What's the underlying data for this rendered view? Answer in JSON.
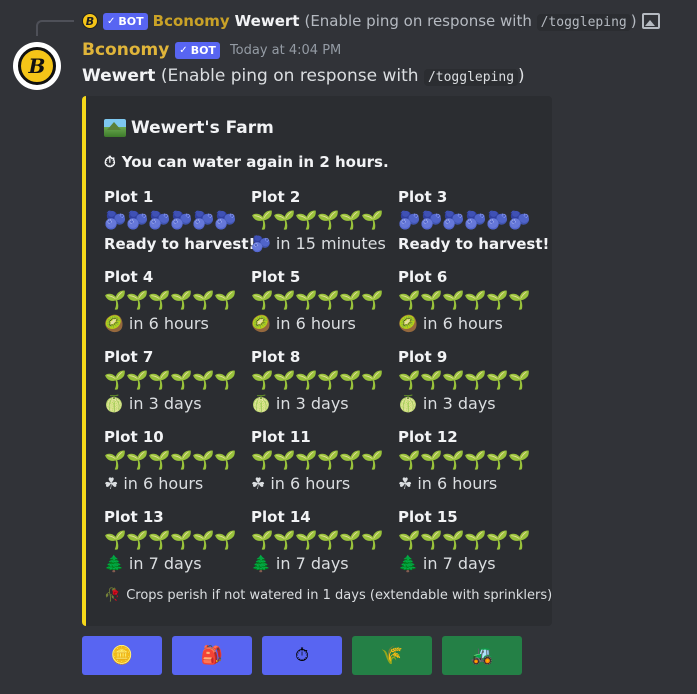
{
  "reply": {
    "bot_tag": "BOT",
    "author": "Bconomy",
    "user": "Wewert",
    "text_before": "(Enable ping on response with",
    "command": "/toggleping",
    "text_after": ")",
    "image_icon": "image-icon"
  },
  "message": {
    "avatar_letter": "B",
    "author": "Bconomy",
    "bot_tag": "BOT",
    "timestamp": "Today at 4:04 PM",
    "user": "Wewert",
    "text_before": "(Enable ping on response with",
    "command": "/toggleping",
    "text_after": ")"
  },
  "embed": {
    "accent_color": "#f6d81a",
    "title": "Wewert's Farm",
    "title_icon": "farm-landscape-icon",
    "water_icon": "⏱",
    "water_text": "You can water again in 2 hours.",
    "plots": [
      {
        "name": "Plot 1",
        "plants": [
          "🫐",
          "🫐",
          "🫐",
          "🫐",
          "🫐",
          "🫐"
        ],
        "status_icon": "",
        "status": "Ready to harvest!",
        "ready": true
      },
      {
        "name": "Plot 2",
        "plants": [
          "🌱",
          "🌱",
          "🌱",
          "🌱",
          "🌱",
          "🌱"
        ],
        "status_icon": "🫐",
        "status": "in 15 minutes",
        "ready": false
      },
      {
        "name": "Plot 3",
        "plants": [
          "🫐",
          "🫐",
          "🫐",
          "🫐",
          "🫐",
          "🫐"
        ],
        "status_icon": "",
        "status": "Ready to harvest!",
        "ready": true
      },
      {
        "name": "Plot 4",
        "plants": [
          "🌱",
          "🌱",
          "🌱",
          "🌱",
          "🌱",
          "🌱"
        ],
        "status_icon": "🥝",
        "status": "in 6 hours",
        "ready": false
      },
      {
        "name": "Plot 5",
        "plants": [
          "🌱",
          "🌱",
          "🌱",
          "🌱",
          "🌱",
          "🌱"
        ],
        "status_icon": "🥝",
        "status": "in 6 hours",
        "ready": false
      },
      {
        "name": "Plot 6",
        "plants": [
          "🌱",
          "🌱",
          "🌱",
          "🌱",
          "🌱",
          "🌱"
        ],
        "status_icon": "🥝",
        "status": "in 6 hours",
        "ready": false
      },
      {
        "name": "Plot 7",
        "plants": [
          "🌱",
          "🌱",
          "🌱",
          "🌱",
          "🌱",
          "🌱"
        ],
        "status_icon": "🍈",
        "status": "in 3 days",
        "ready": false
      },
      {
        "name": "Plot 8",
        "plants": [
          "🌱",
          "🌱",
          "🌱",
          "🌱",
          "🌱",
          "🌱"
        ],
        "status_icon": "🍈",
        "status": "in 3 days",
        "ready": false
      },
      {
        "name": "Plot 9",
        "plants": [
          "🌱",
          "🌱",
          "🌱",
          "🌱",
          "🌱",
          "🌱"
        ],
        "status_icon": "🍈",
        "status": "in 3 days",
        "ready": false
      },
      {
        "name": "Plot 10",
        "plants": [
          "🌱",
          "🌱",
          "🌱",
          "🌱",
          "🌱",
          "🌱"
        ],
        "status_icon": "☘",
        "status": "in 6 hours",
        "ready": false
      },
      {
        "name": "Plot 11",
        "plants": [
          "🌱",
          "🌱",
          "🌱",
          "🌱",
          "🌱",
          "🌱"
        ],
        "status_icon": "☘",
        "status": "in 6 hours",
        "ready": false
      },
      {
        "name": "Plot 12",
        "plants": [
          "🌱",
          "🌱",
          "🌱",
          "🌱",
          "🌱",
          "🌱"
        ],
        "status_icon": "☘",
        "status": "in 6 hours",
        "ready": false
      },
      {
        "name": "Plot 13",
        "plants": [
          "🌱",
          "🌱",
          "🌱",
          "🌱",
          "🌱",
          "🌱"
        ],
        "status_icon": "🌲",
        "status": "in 7 days",
        "ready": false
      },
      {
        "name": "Plot 14",
        "plants": [
          "🌱",
          "🌱",
          "🌱",
          "🌱",
          "🌱",
          "🌱"
        ],
        "status_icon": "🌲",
        "status": "in 7 days",
        "ready": false
      },
      {
        "name": "Plot 15",
        "plants": [
          "🌱",
          "🌱",
          "🌱",
          "🌱",
          "🌱",
          "🌱"
        ],
        "status_icon": "🌲",
        "status": "in 7 days",
        "ready": false
      }
    ],
    "footer_icon": "🥀",
    "footer": "Crops perish if not watered in 1 days (extendable with sprinklers)"
  },
  "buttons": [
    {
      "icon": "🪙",
      "icon_name": "coin-icon",
      "style": "blurple"
    },
    {
      "icon": "🎒",
      "icon_name": "backpack-icon",
      "style": "blurple"
    },
    {
      "icon": "⏱",
      "icon_name": "stopwatch-icon",
      "style": "blurple"
    },
    {
      "icon": "🌾",
      "icon_name": "harvest-icon",
      "style": "green"
    },
    {
      "icon": "🚜",
      "icon_name": "tractor-icon",
      "style": "green"
    }
  ]
}
